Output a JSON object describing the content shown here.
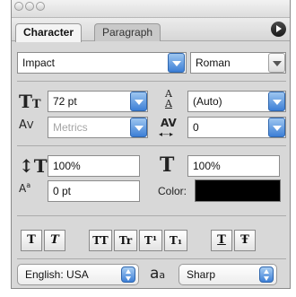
{
  "tabs": [
    {
      "label": "Character",
      "active": true
    },
    {
      "label": "Paragraph",
      "active": false
    }
  ],
  "font": {
    "family": "Impact",
    "style": "Roman"
  },
  "size": {
    "value": "72 pt"
  },
  "leading": {
    "value": "(Auto)"
  },
  "kerning": {
    "value": "Metrics"
  },
  "tracking": {
    "value": "0"
  },
  "vertical_scale": {
    "value": "100%"
  },
  "horizontal_scale": {
    "value": "100%"
  },
  "baseline_shift": {
    "value": "0 pt"
  },
  "color": {
    "label": "Color:",
    "swatch": "#000000"
  },
  "style_buttons": [
    "T",
    "T",
    "TT",
    "Tr",
    "T¹",
    "T₁",
    "T",
    "Ŧ"
  ],
  "language": {
    "value": "English: USA"
  },
  "antialias": {
    "icon_text": "a",
    "icon_subtext": "a",
    "value": "Sharp"
  }
}
